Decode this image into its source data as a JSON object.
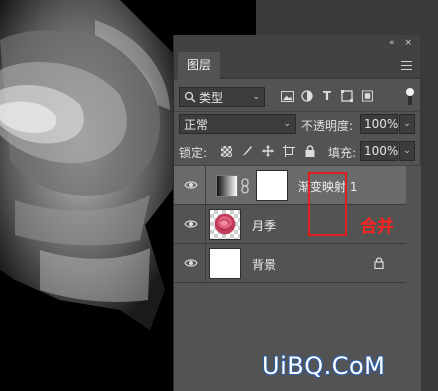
{
  "panel": {
    "topbar": {
      "collapse_glyph": "«",
      "close_glyph": "×"
    },
    "tab_label": "图层"
  },
  "filter": {
    "kind_label": "类型",
    "icons": [
      "image-filter-icon",
      "adjustment-filter-icon",
      "type-filter-icon",
      "shape-filter-icon",
      "smart-object-filter-icon"
    ],
    "type_glyph": "T"
  },
  "blend": {
    "mode": "正常",
    "opacity_label": "不透明度:",
    "opacity_value": "100%"
  },
  "lock": {
    "label": "锁定:",
    "fill_label": "填充:",
    "fill_value": "100%"
  },
  "layers": [
    {
      "name": "渐变映射 1",
      "selected": true,
      "type": "gradient-map-adjustment"
    },
    {
      "name": "月季",
      "selected": false,
      "type": "pixel"
    },
    {
      "name": "背景",
      "selected": false,
      "type": "background",
      "locked": true
    }
  ],
  "annotation": {
    "merge_label": "合并",
    "box_color": "#e0201c"
  },
  "watermark": "UiBQ.CoM",
  "colors": {
    "panel_bg": "#535353",
    "selected_layer": "#6a6a6a",
    "annotation_red": "#ff2020"
  }
}
